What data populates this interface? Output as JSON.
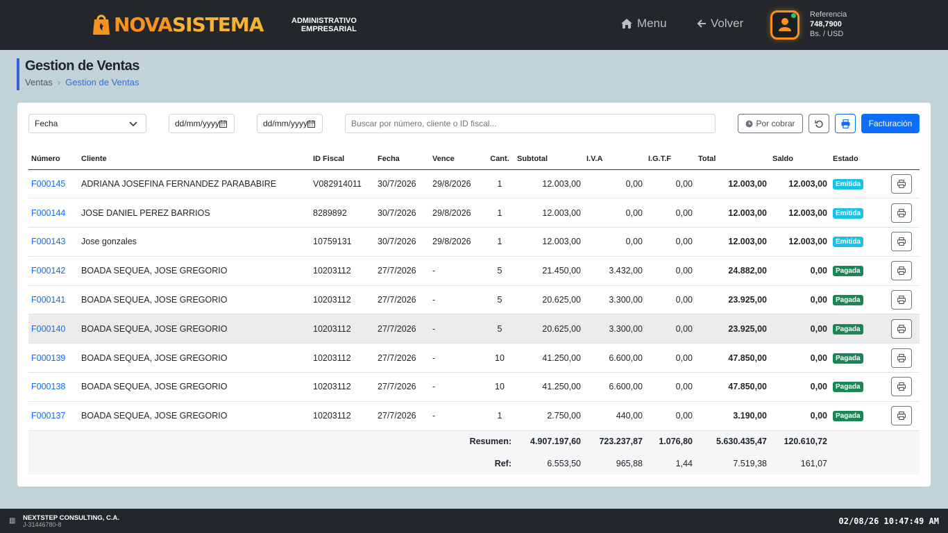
{
  "brand": {
    "name_part1": "NOVA",
    "name_part2": "SISTEMA",
    "sub_line1": "ADMINISTRATIVO",
    "sub_line2": "EMPRESARIAL",
    "color_primary": "#f7931e",
    "color_secondary": "#f9b233"
  },
  "topnav": {
    "menu_label": "Menu",
    "back_label": "Volver"
  },
  "reference": {
    "label": "Referencia",
    "value": "748,7900",
    "unit": "Bs. / USD"
  },
  "page": {
    "title": "Gestion de Ventas",
    "breadcrumb": [
      "Ventas",
      "Gestion de Ventas"
    ]
  },
  "filters": {
    "date_field_select": "Fecha",
    "date_from_placeholder": "dd/mm/yyyy",
    "date_to_placeholder": "dd/mm/yyyy",
    "search_placeholder": "Buscar por número, cliente o ID fiscal...",
    "por_cobrar_label": "Por cobrar",
    "facturacion_label": "Facturación"
  },
  "table": {
    "headers": [
      "Número",
      "Cliente",
      "ID Fiscal",
      "Fecha",
      "Vence",
      "Cant.",
      "Subtotal",
      "I.V.A",
      "I.G.T.F",
      "Total",
      "Saldo",
      "Estado",
      ""
    ],
    "rows": [
      {
        "numero": "F000145",
        "cliente": "ADRIANA JOSEFINA FERNANDEZ PARABABIRE",
        "id_fiscal": "V082914011",
        "fecha": "30/7/2026",
        "vence": "29/8/2026",
        "cant": "1",
        "subtotal": "12.003,00",
        "iva": "0,00",
        "igtf": "0,00",
        "total": "12.003,00",
        "saldo": "12.003,00",
        "estado": "Emitida"
      },
      {
        "numero": "F000144",
        "cliente": "JOSE DANIEL PEREZ BARRIOS",
        "id_fiscal": "8289892",
        "fecha": "30/7/2026",
        "vence": "29/8/2026",
        "cant": "1",
        "subtotal": "12.003,00",
        "iva": "0,00",
        "igtf": "0,00",
        "total": "12.003,00",
        "saldo": "12.003,00",
        "estado": "Emitida"
      },
      {
        "numero": "F000143",
        "cliente": "Jose gonzales",
        "id_fiscal": "10759131",
        "fecha": "30/7/2026",
        "vence": "29/8/2026",
        "cant": "1",
        "subtotal": "12.003,00",
        "iva": "0,00",
        "igtf": "0,00",
        "total": "12.003,00",
        "saldo": "12.003,00",
        "estado": "Emitida"
      },
      {
        "numero": "F000142",
        "cliente": "BOADA SEQUEA, JOSE GREGORIO",
        "id_fiscal": "10203112",
        "fecha": "27/7/2026",
        "vence": "-",
        "cant": "5",
        "subtotal": "21.450,00",
        "iva": "3.432,00",
        "igtf": "0,00",
        "total": "24.882,00",
        "saldo": "0,00",
        "estado": "Pagada"
      },
      {
        "numero": "F000141",
        "cliente": "BOADA SEQUEA, JOSE GREGORIO",
        "id_fiscal": "10203112",
        "fecha": "27/7/2026",
        "vence": "-",
        "cant": "5",
        "subtotal": "20.625,00",
        "iva": "3.300,00",
        "igtf": "0,00",
        "total": "23.925,00",
        "saldo": "0,00",
        "estado": "Pagada"
      },
      {
        "numero": "F000140",
        "cliente": "BOADA SEQUEA, JOSE GREGORIO",
        "id_fiscal": "10203112",
        "fecha": "27/7/2026",
        "vence": "-",
        "cant": "5",
        "subtotal": "20.625,00",
        "iva": "3.300,00",
        "igtf": "0,00",
        "total": "23.925,00",
        "saldo": "0,00",
        "estado": "Pagada"
      },
      {
        "numero": "F000139",
        "cliente": "BOADA SEQUEA, JOSE GREGORIO",
        "id_fiscal": "10203112",
        "fecha": "27/7/2026",
        "vence": "-",
        "cant": "10",
        "subtotal": "41.250,00",
        "iva": "6.600,00",
        "igtf": "0,00",
        "total": "47.850,00",
        "saldo": "0,00",
        "estado": "Pagada"
      },
      {
        "numero": "F000138",
        "cliente": "BOADA SEQUEA, JOSE GREGORIO",
        "id_fiscal": "10203112",
        "fecha": "27/7/2026",
        "vence": "-",
        "cant": "10",
        "subtotal": "41.250,00",
        "iva": "6.600,00",
        "igtf": "0,00",
        "total": "47.850,00",
        "saldo": "0,00",
        "estado": "Pagada"
      },
      {
        "numero": "F000137",
        "cliente": "BOADA SEQUEA, JOSE GREGORIO",
        "id_fiscal": "10203112",
        "fecha": "27/7/2026",
        "vence": "-",
        "cant": "1",
        "subtotal": "2.750,00",
        "iva": "440,00",
        "igtf": "0,00",
        "total": "3.190,00",
        "saldo": "0,00",
        "estado": "Pagada"
      }
    ],
    "summary": {
      "label": "Resumen:",
      "subtotal": "4.907.197,60",
      "iva": "723.237,87",
      "igtf": "1.076,80",
      "total": "5.630.435,47",
      "saldo": "120.610,72"
    },
    "ref": {
      "label": "Ref:",
      "subtotal": "6.553,50",
      "iva": "965,88",
      "igtf": "1,44",
      "total": "7.519,38",
      "saldo": "161,07"
    }
  },
  "status_colors": {
    "Emitida": "#17c1e8",
    "Pagada": "#198754"
  },
  "footer": {
    "company": "NEXTSTEP CONSULTING, C.A.",
    "rif": "J-31446780-8",
    "clock": "02/08/26 10:47:49 AM"
  }
}
